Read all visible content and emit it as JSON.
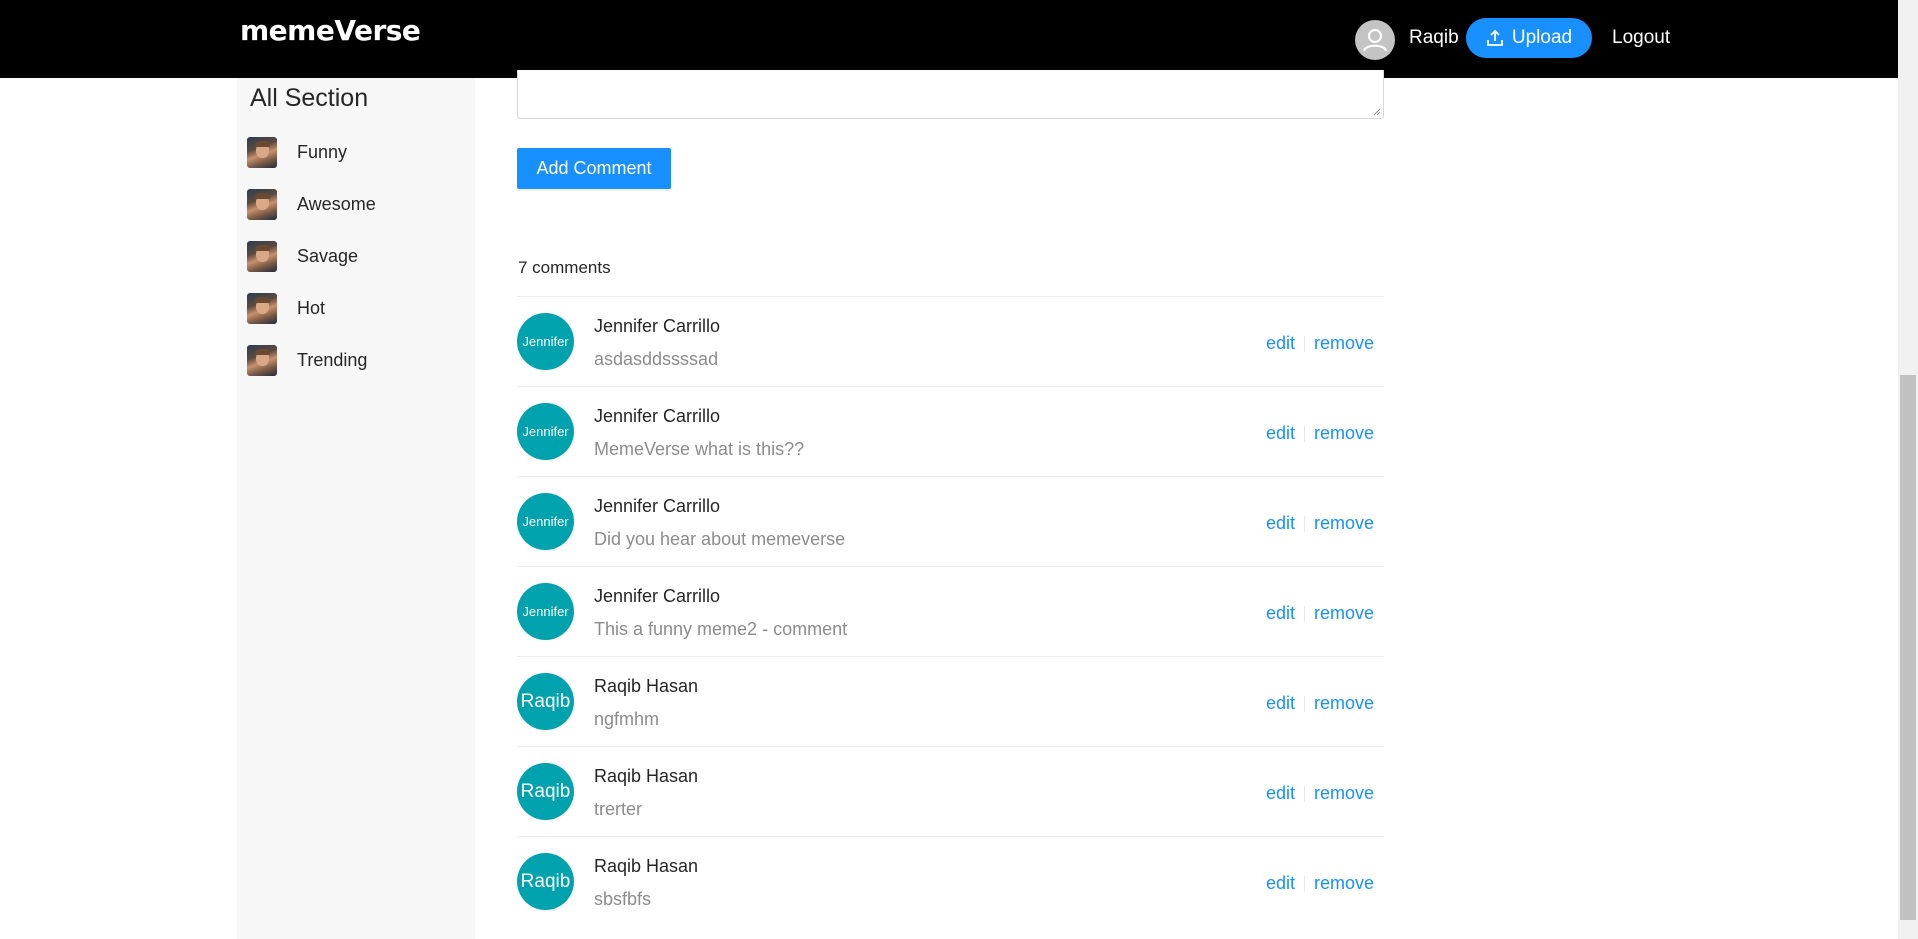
{
  "header": {
    "logo": "memeVerse",
    "user_name": "Raqib",
    "upload_label": "Upload",
    "logout_label": "Logout",
    "user_icon": "user-icon",
    "upload_icon": "upload-icon"
  },
  "sidebar": {
    "title": "All Section",
    "items": [
      {
        "label": "Funny"
      },
      {
        "label": "Awesome"
      },
      {
        "label": "Savage"
      },
      {
        "label": "Hot"
      },
      {
        "label": "Trending"
      }
    ]
  },
  "main": {
    "add_comment_label": "Add Comment",
    "comment_count": "7 comments",
    "comments": [
      {
        "avatar": "Jennifer",
        "author": "Jennifer Carrillo",
        "text": "asdasddssssad",
        "edit": "edit",
        "remove": "remove"
      },
      {
        "avatar": "Jennifer",
        "author": "Jennifer Carrillo",
        "text": "MemeVerse what is this??",
        "edit": "edit",
        "remove": "remove"
      },
      {
        "avatar": "Jennifer",
        "author": "Jennifer Carrillo",
        "text": "Did you hear about memeverse",
        "edit": "edit",
        "remove": "remove"
      },
      {
        "avatar": "Jennifer",
        "author": "Jennifer Carrillo",
        "text": "This a funny meme2 - comment",
        "edit": "edit",
        "remove": "remove"
      },
      {
        "avatar": "Raqib",
        "author": "Raqib Hasan",
        "text": "ngfmhm",
        "edit": "edit",
        "remove": "remove"
      },
      {
        "avatar": "Raqib",
        "author": "Raqib Hasan",
        "text": "trerter",
        "edit": "edit",
        "remove": "remove"
      },
      {
        "avatar": "Raqib",
        "author": "Raqib Hasan",
        "text": "sbsfbfs",
        "edit": "edit",
        "remove": "remove"
      }
    ]
  },
  "colors": {
    "header_bg": "#000000",
    "accent": "#1890ff",
    "avatar_bg": "#00a2ae",
    "sidebar_bg": "#f7f7f7"
  }
}
